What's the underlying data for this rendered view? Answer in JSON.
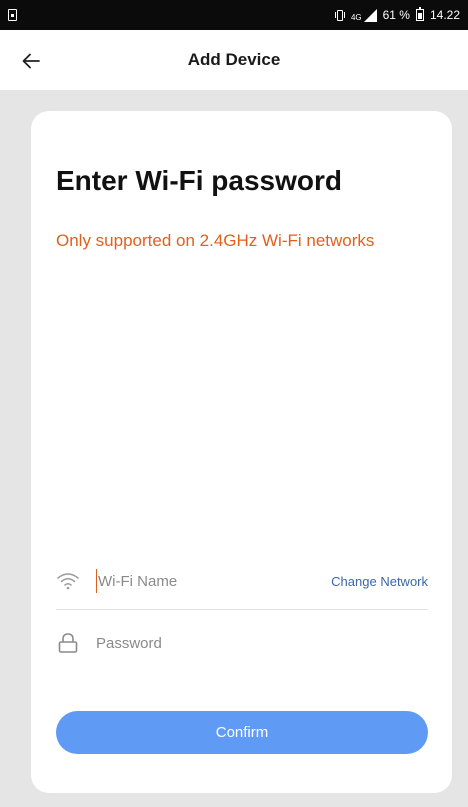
{
  "status_bar": {
    "network_label": "4G",
    "battery_percent": "61 %",
    "time": "14.22",
    "icons": [
      "sim-icon",
      "vibrate-icon",
      "signal-icon",
      "battery-icon"
    ]
  },
  "header": {
    "title": "Add Device",
    "back_icon": "arrow-left-icon"
  },
  "card": {
    "title": "Enter Wi-Fi password",
    "notice": "Only supported on 2.4GHz Wi-Fi networks",
    "wifi_field": {
      "icon": "wifi-icon",
      "placeholder": "Wi-Fi Name",
      "value": ""
    },
    "change_network_label": "Change Network",
    "password_field": {
      "icon": "lock-icon",
      "placeholder": "Password",
      "value": ""
    },
    "confirm_label": "Confirm"
  },
  "colors": {
    "accent_orange": "#e35f1f",
    "button_blue": "#5f9bf5",
    "link_blue": "#3a66b0",
    "background_gray": "#e5e5e5"
  }
}
